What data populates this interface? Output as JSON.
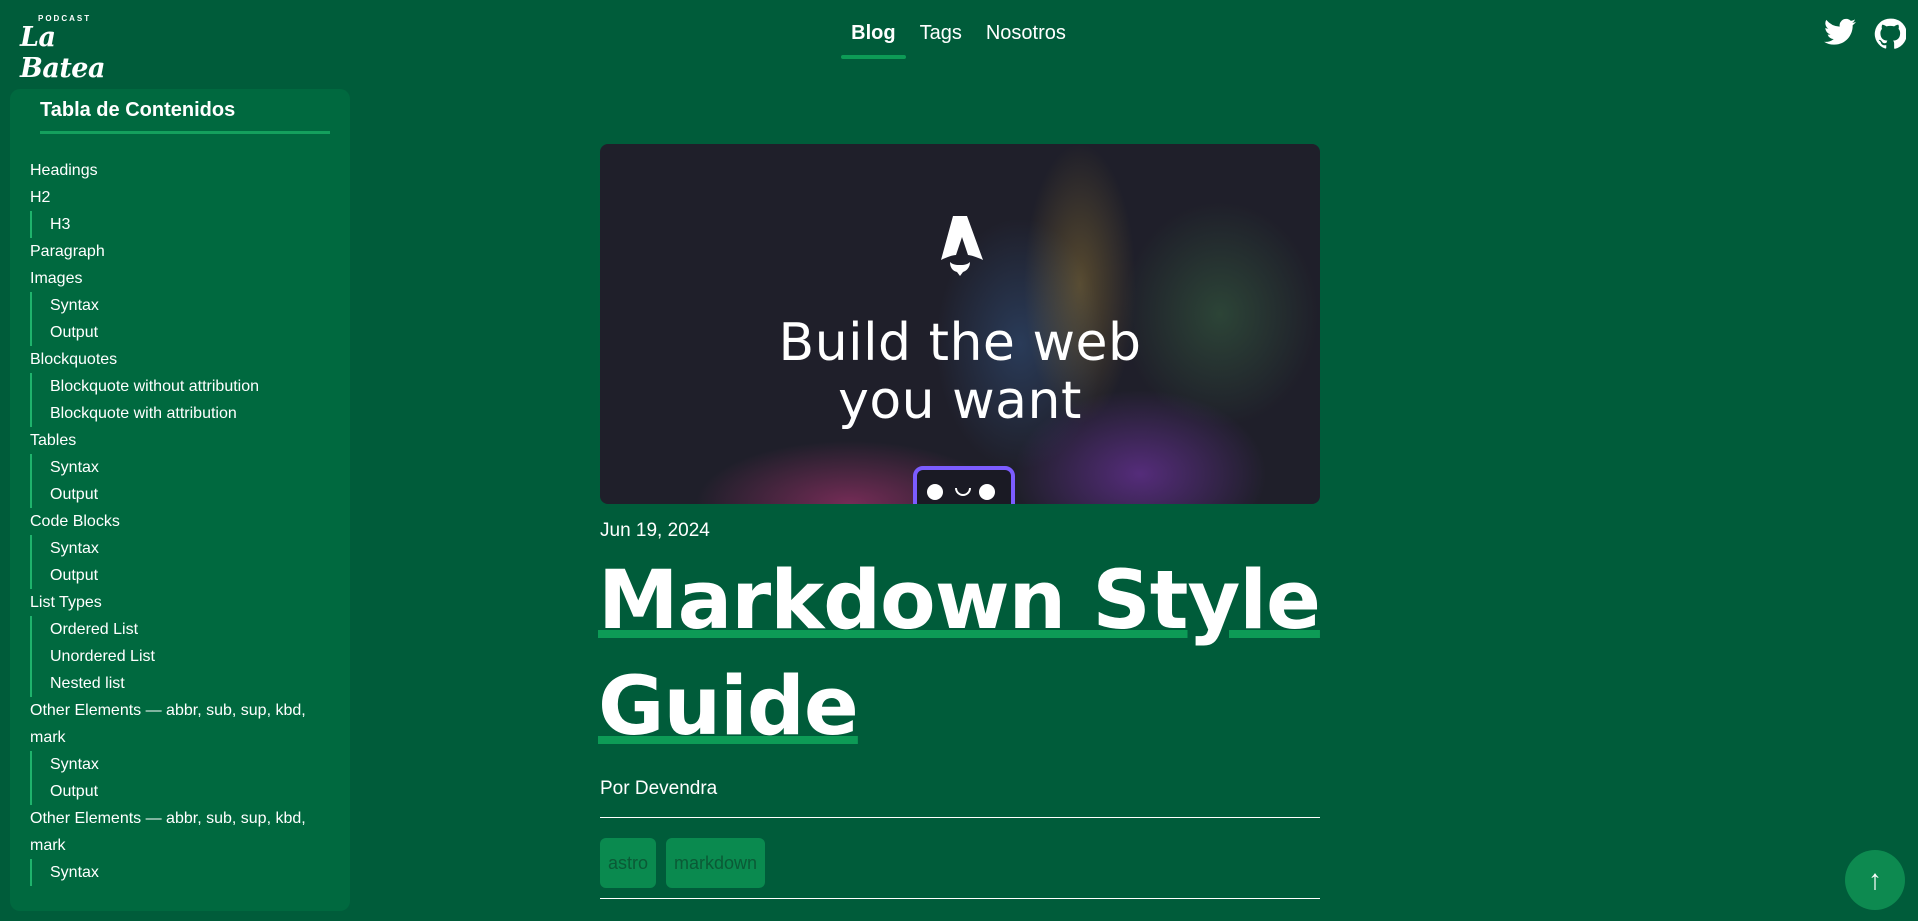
{
  "header": {
    "logo_small": "PODCAST",
    "logo_big": "La Batea",
    "nav": [
      "Blog",
      "Tags",
      "Nosotros"
    ],
    "social": [
      "twitter-icon",
      "github-icon"
    ]
  },
  "toc": {
    "title": "Tabla de Contenidos",
    "items": [
      {
        "level": 1,
        "label": "Headings"
      },
      {
        "level": 1,
        "label": "H2"
      },
      {
        "level": 2,
        "label": "H3"
      },
      {
        "level": 1,
        "label": "Paragraph"
      },
      {
        "level": 1,
        "label": "Images"
      },
      {
        "level": 2,
        "label": "Syntax"
      },
      {
        "level": 2,
        "label": "Output"
      },
      {
        "level": 1,
        "label": "Blockquotes"
      },
      {
        "level": 2,
        "label": "Blockquote without attribution"
      },
      {
        "level": 2,
        "label": "Blockquote with attribution"
      },
      {
        "level": 1,
        "label": "Tables"
      },
      {
        "level": 2,
        "label": "Syntax"
      },
      {
        "level": 2,
        "label": "Output"
      },
      {
        "level": 1,
        "label": "Code Blocks"
      },
      {
        "level": 2,
        "label": "Syntax"
      },
      {
        "level": 2,
        "label": "Output"
      },
      {
        "level": 1,
        "label": "List Types"
      },
      {
        "level": 2,
        "label": "Ordered List"
      },
      {
        "level": 2,
        "label": "Unordered List"
      },
      {
        "level": 2,
        "label": "Nested list"
      },
      {
        "level": 1,
        "label": "Other Elements — abbr, sub, sup, kbd, mark"
      },
      {
        "level": 2,
        "label": "Syntax"
      },
      {
        "level": 2,
        "label": "Output"
      },
      {
        "level": 1,
        "label": "Other Elements — abbr, sub, sup, kbd, mark"
      },
      {
        "level": 2,
        "label": "Syntax"
      }
    ]
  },
  "post": {
    "hero_text_1": "Build the web",
    "hero_text_2": "you want",
    "date": "Jun 19, 2024",
    "title_line1": "Markdown Style",
    "title_line2": "Guide",
    "author": "Por Devendra",
    "tags": [
      "astro",
      "markdown"
    ]
  },
  "scroll_top": "↑"
}
